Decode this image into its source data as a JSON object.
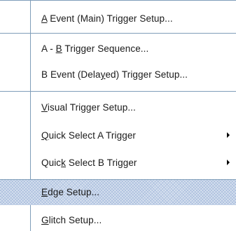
{
  "menu": {
    "items": [
      {
        "pre": "",
        "u": "A",
        "post": " Event (Main) Trigger Setup...",
        "submenu": false,
        "highlighted": false
      },
      {
        "pre": "A - ",
        "u": "B",
        "post": " Trigger Sequence...",
        "submenu": false,
        "highlighted": false
      },
      {
        "pre": "B Event (Dela",
        "u": "y",
        "post": "ed) Trigger Setup...",
        "submenu": false,
        "highlighted": false
      },
      {
        "pre": "",
        "u": "V",
        "post": "isual Trigger Setup...",
        "submenu": false,
        "highlighted": false
      },
      {
        "pre": "",
        "u": "Q",
        "post": "uick Select A Trigger",
        "submenu": true,
        "highlighted": false
      },
      {
        "pre": "Quic",
        "u": "k",
        "post": " Select B Trigger",
        "submenu": true,
        "highlighted": false
      },
      {
        "pre": "",
        "u": "E",
        "post": "dge Setup...",
        "submenu": false,
        "highlighted": true
      },
      {
        "pre": "",
        "u": "G",
        "post": "litch Setup...",
        "submenu": false,
        "highlighted": false
      }
    ],
    "submenu_icon": "submenu-arrow-icon",
    "colors": {
      "separator": "#7f9db9",
      "highlight": "#d8e2f0",
      "text": "#1a1a1a"
    }
  }
}
